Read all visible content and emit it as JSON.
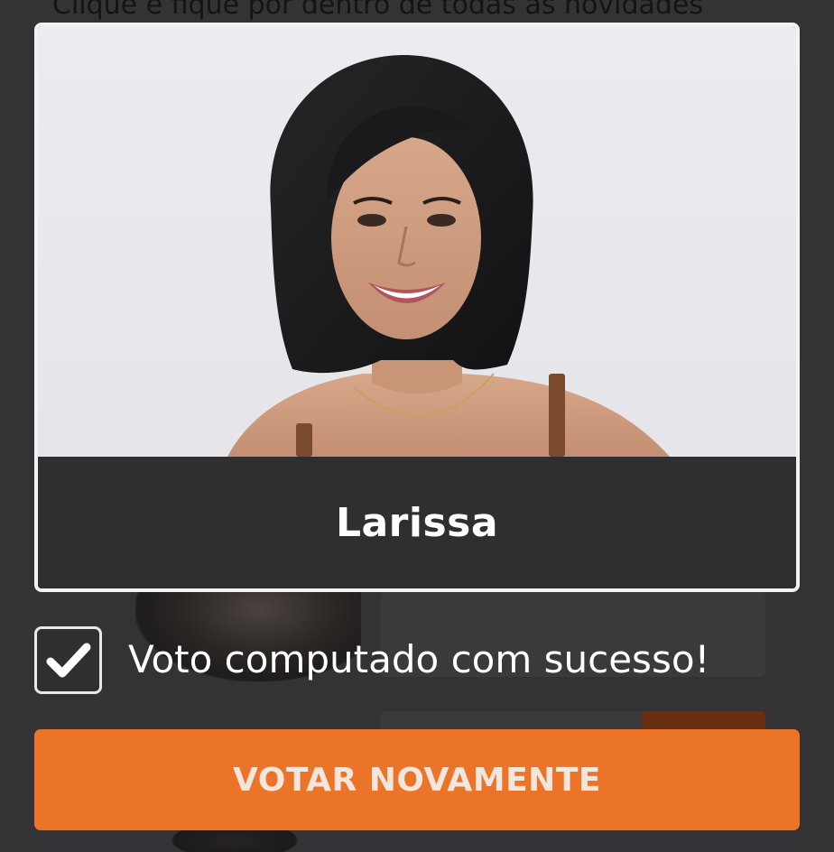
{
  "background": {
    "headline": "Clique e fique por dentro de todas as novidades"
  },
  "candidate": {
    "name": "Larissa",
    "photo_icon": "candidate-photo"
  },
  "vote_status": {
    "checked": true,
    "message": "Voto computado com sucesso!"
  },
  "actions": {
    "vote_again_label": "VOTAR NOVAMENTE"
  },
  "colors": {
    "accent": "#ec7429",
    "overlay_bg": "#2f2f31",
    "text": "#ffffff"
  }
}
